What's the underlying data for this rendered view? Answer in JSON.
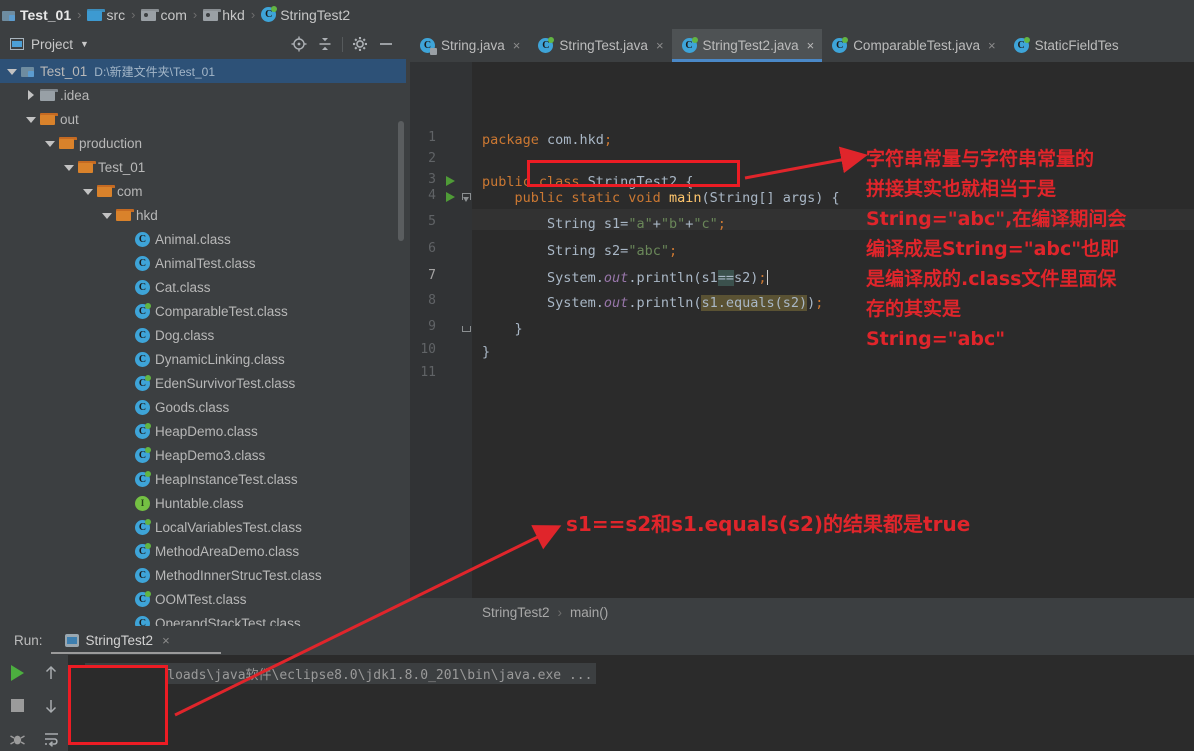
{
  "breadcrumb": {
    "items": [
      {
        "label": "Test_01",
        "icon": "module-icon"
      },
      {
        "label": "src",
        "icon": "folder-icon"
      },
      {
        "label": "com",
        "icon": "package-icon"
      },
      {
        "label": "hkd",
        "icon": "package-icon"
      },
      {
        "label": "StringTest2",
        "icon": "class-icon"
      }
    ],
    "separator": "›"
  },
  "project_panel": {
    "title": "Project",
    "caret": "▼",
    "tools": [
      "locate-icon",
      "collapse-all-icon",
      "gear-icon",
      "minimize-icon"
    ],
    "tree": [
      {
        "indent": 0,
        "arrow": "down",
        "icon": "module-icon",
        "label": "Test_01",
        "path": "D:\\新建文件夹\\Test_01",
        "selected": true
      },
      {
        "indent": 1,
        "arrow": "right",
        "icon": "folder-grey",
        "label": ".idea"
      },
      {
        "indent": 1,
        "arrow": "down",
        "icon": "folder-orange",
        "label": "out"
      },
      {
        "indent": 2,
        "arrow": "down",
        "icon": "folder-orange",
        "label": "production"
      },
      {
        "indent": 3,
        "arrow": "down",
        "icon": "folder-orange",
        "label": "Test_01"
      },
      {
        "indent": 4,
        "arrow": "down",
        "icon": "folder-orange",
        "label": "com"
      },
      {
        "indent": 5,
        "arrow": "down",
        "icon": "folder-orange",
        "label": "hkd"
      },
      {
        "indent": 6,
        "arrow": "none",
        "icon": "class-icon",
        "label": "Animal.class"
      },
      {
        "indent": 6,
        "arrow": "none",
        "icon": "class-icon",
        "label": "AnimalTest.class"
      },
      {
        "indent": 6,
        "arrow": "none",
        "icon": "class-icon",
        "label": "Cat.class"
      },
      {
        "indent": 6,
        "arrow": "none",
        "icon": "class-run-icon",
        "label": "ComparableTest.class"
      },
      {
        "indent": 6,
        "arrow": "none",
        "icon": "class-icon",
        "label": "Dog.class"
      },
      {
        "indent": 6,
        "arrow": "none",
        "icon": "class-icon",
        "label": "DynamicLinking.class"
      },
      {
        "indent": 6,
        "arrow": "none",
        "icon": "class-run-icon",
        "label": "EdenSurvivorTest.class"
      },
      {
        "indent": 6,
        "arrow": "none",
        "icon": "class-icon",
        "label": "Goods.class"
      },
      {
        "indent": 6,
        "arrow": "none",
        "icon": "class-run-icon",
        "label": "HeapDemo.class"
      },
      {
        "indent": 6,
        "arrow": "none",
        "icon": "class-run-icon",
        "label": "HeapDemo3.class"
      },
      {
        "indent": 6,
        "arrow": "none",
        "icon": "class-run-icon",
        "label": "HeapInstanceTest.class"
      },
      {
        "indent": 6,
        "arrow": "none",
        "icon": "interface-icon",
        "label": "Huntable.class"
      },
      {
        "indent": 6,
        "arrow": "none",
        "icon": "class-run-icon",
        "label": "LocalVariablesTest.class"
      },
      {
        "indent": 6,
        "arrow": "none",
        "icon": "class-run-icon",
        "label": "MethodAreaDemo.class"
      },
      {
        "indent": 6,
        "arrow": "none",
        "icon": "class-icon",
        "label": "MethodInnerStrucTest.class"
      },
      {
        "indent": 6,
        "arrow": "none",
        "icon": "class-run-icon",
        "label": "OOMTest.class"
      },
      {
        "indent": 6,
        "arrow": "none",
        "icon": "class-icon",
        "label": "OperandStackTest.class"
      }
    ]
  },
  "editor_tabs": [
    {
      "label": "String.java",
      "icon": "class-lib-icon",
      "active": false,
      "close": "×"
    },
    {
      "label": "StringTest.java",
      "icon": "class-run-icon",
      "active": false,
      "close": "×"
    },
    {
      "label": "StringTest2.java",
      "icon": "class-run-icon",
      "active": true,
      "close": "×"
    },
    {
      "label": "ComparableTest.java",
      "icon": "class-run-icon",
      "active": false,
      "close": "×"
    },
    {
      "label": "StaticFieldTes",
      "icon": "class-run-icon",
      "active": false,
      "close": ""
    }
  ],
  "editor": {
    "line_numbers": [
      "1",
      "2",
      "3",
      "4",
      "5",
      "6",
      "7",
      "8",
      "9",
      "10",
      "11"
    ],
    "current_line": 7,
    "run_gutter_lines": [
      3,
      4
    ],
    "lines": [
      "package com.hkd;",
      "",
      "public class StringTest2 {",
      "    public static void main(String[] args) {",
      "        String s1=\"a\"+\"b\"+\"c\";",
      "        String s2=\"abc\";",
      "        System.out.println(s1==s2);",
      "        System.out.println(s1.equals(s2));",
      "    }",
      "}",
      ""
    ]
  },
  "editor_breadcrumb": {
    "class": "StringTest2",
    "separator": "›",
    "method": "main()"
  },
  "run_panel": {
    "label": "Run:",
    "tab_name": "StringTest2",
    "tab_close": "×",
    "tools": [
      "rerun-icon",
      "stop-icon",
      "debug-icon",
      "scroll-up-icon",
      "scroll-down-icon",
      "soft-wrap-icon"
    ],
    "console": {
      "command": "C:\\360Downloads\\java软件\\eclipse8.0\\jdk1.8.0_201\\bin\\java.exe ...",
      "output": [
        "true",
        "true"
      ]
    }
  },
  "annotations": {
    "color": "#e0252b",
    "right_note": "字符串常量与字符串常量的\n拼接其实也就相当于是\nString=\"abc\",在编译期间会\n编译成是String=\"abc\"也即\n是编译成的.class文件里面保\n存的其实是\nString=\"abc\"",
    "middle_note": "s1==s2和s1.equals(s2)的结果都是true"
  }
}
